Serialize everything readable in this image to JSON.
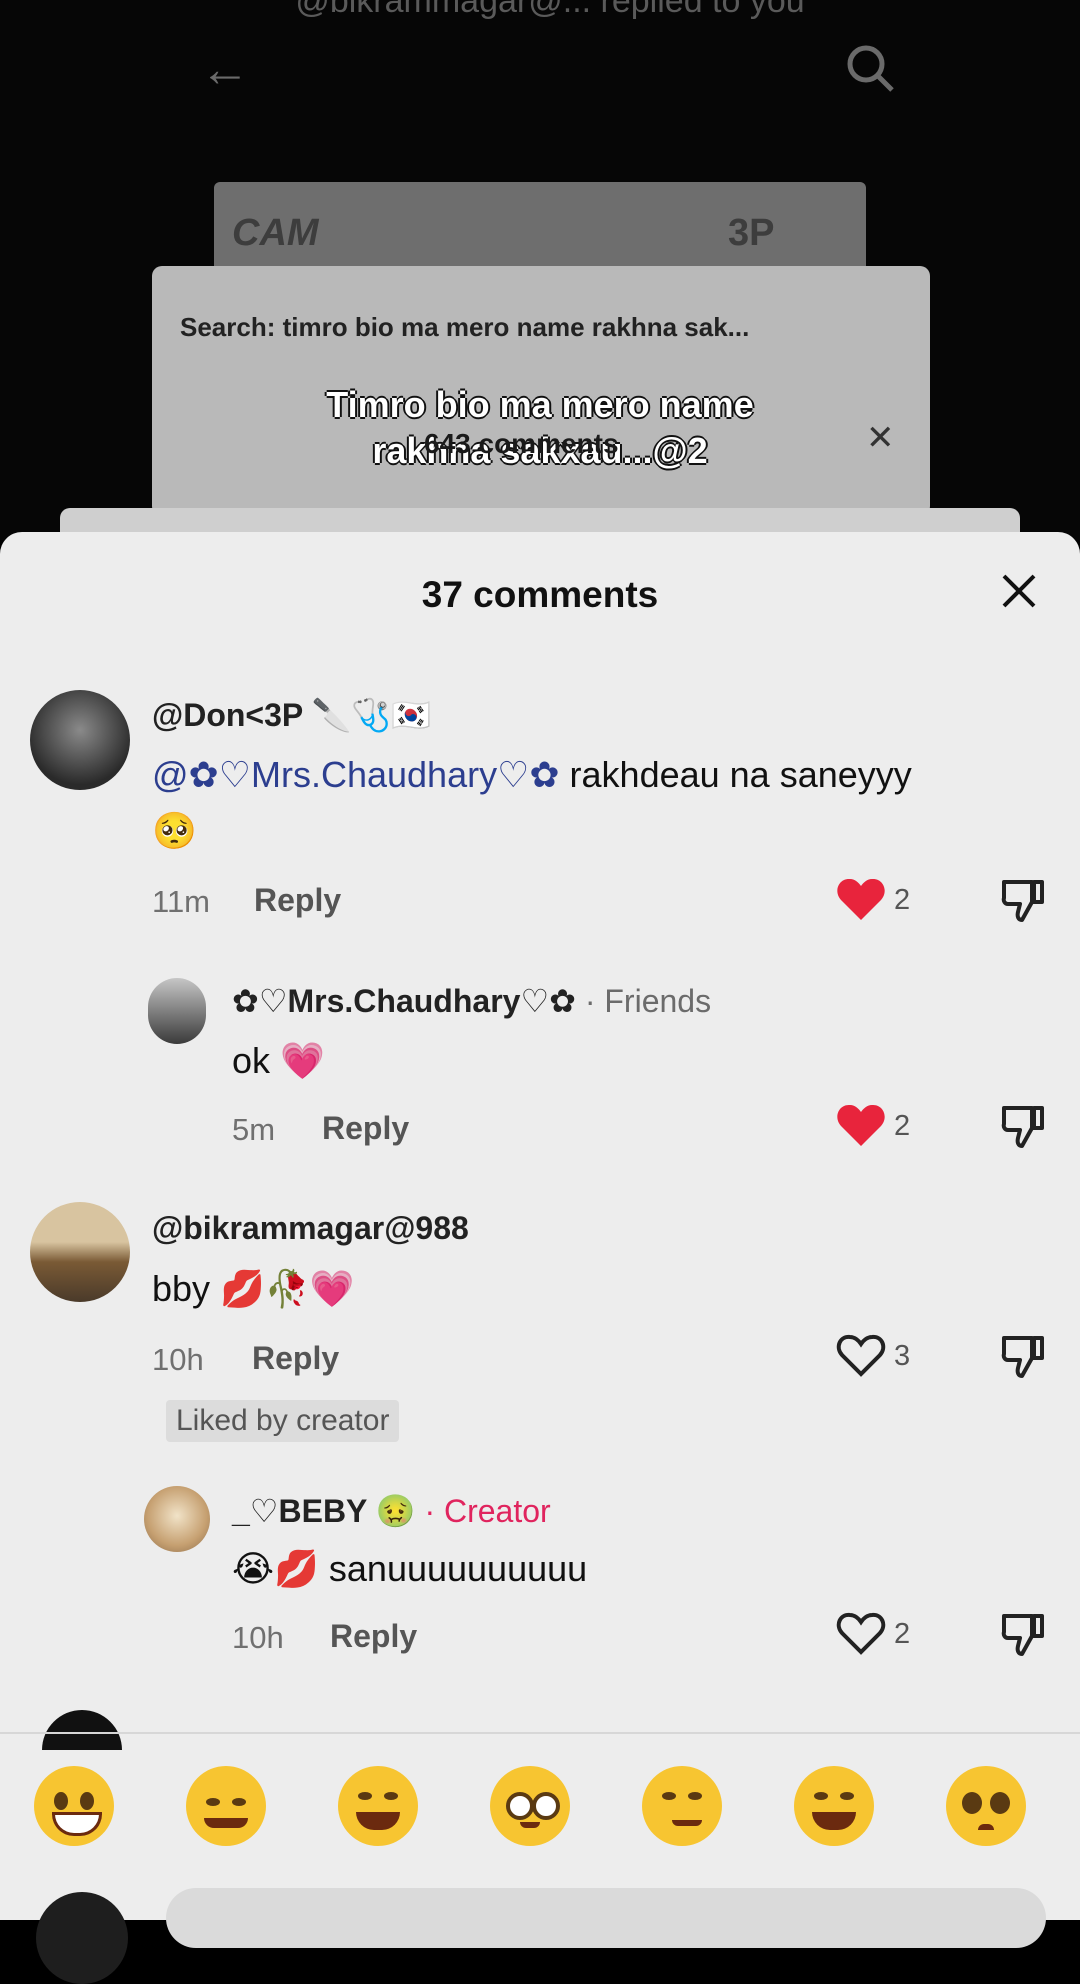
{
  "background": {
    "notification_text": "@bikrammagar@... replied to you",
    "card_left_text": "CAM",
    "card_right_text": "3P",
    "search_text": "Search: timro bio ma mero name rakhna sak...",
    "caption_line1": "Timro bio ma mero name",
    "caption_line2": "rakhna sakxau...@2",
    "comments_count": "643 comments"
  },
  "sheet": {
    "title": "37 comments",
    "close_icon": "close-icon"
  },
  "comments": [
    {
      "username": "@Don<3P",
      "username_emoji": "🔪🩺🇰🇷",
      "mention": "@✿♡Mrs.Chaudhary♡✿",
      "text": "rakhdeau na saneyyy",
      "text_emoji": "🥺",
      "time": "11m",
      "reply": "Reply",
      "likes": "2",
      "liked": true
    },
    {
      "username": "✿♡Mrs.Chaudhary♡✿",
      "tag": "· Friends",
      "text": "ok",
      "text_emoji": "💗",
      "time": "5m",
      "reply": "Reply",
      "likes": "2",
      "liked": true
    },
    {
      "username": "@bikrammagar@988",
      "text": "bby",
      "text_emoji": "💋🥀💗",
      "time": "10h",
      "reply": "Reply",
      "likes": "3",
      "liked": false,
      "badge": "Liked by creator"
    },
    {
      "username": "_♡BEBY",
      "username_emoji": "🤢",
      "tag": "· Creator",
      "text": "sanuuuuuuuuuu",
      "text_emoji": "😭💋",
      "time": "10h",
      "reply": "Reply",
      "likes": "2",
      "liked": false
    }
  ],
  "emoji_bar": [
    "😁",
    "🥰",
    "😂",
    "😳",
    "😏",
    "😅",
    "🥺"
  ],
  "colors": {
    "sheet_bg": "#ededed",
    "heart_red": "#e8243c",
    "creator_pink": "#e0245e",
    "mention_blue": "#2c3e8f"
  }
}
